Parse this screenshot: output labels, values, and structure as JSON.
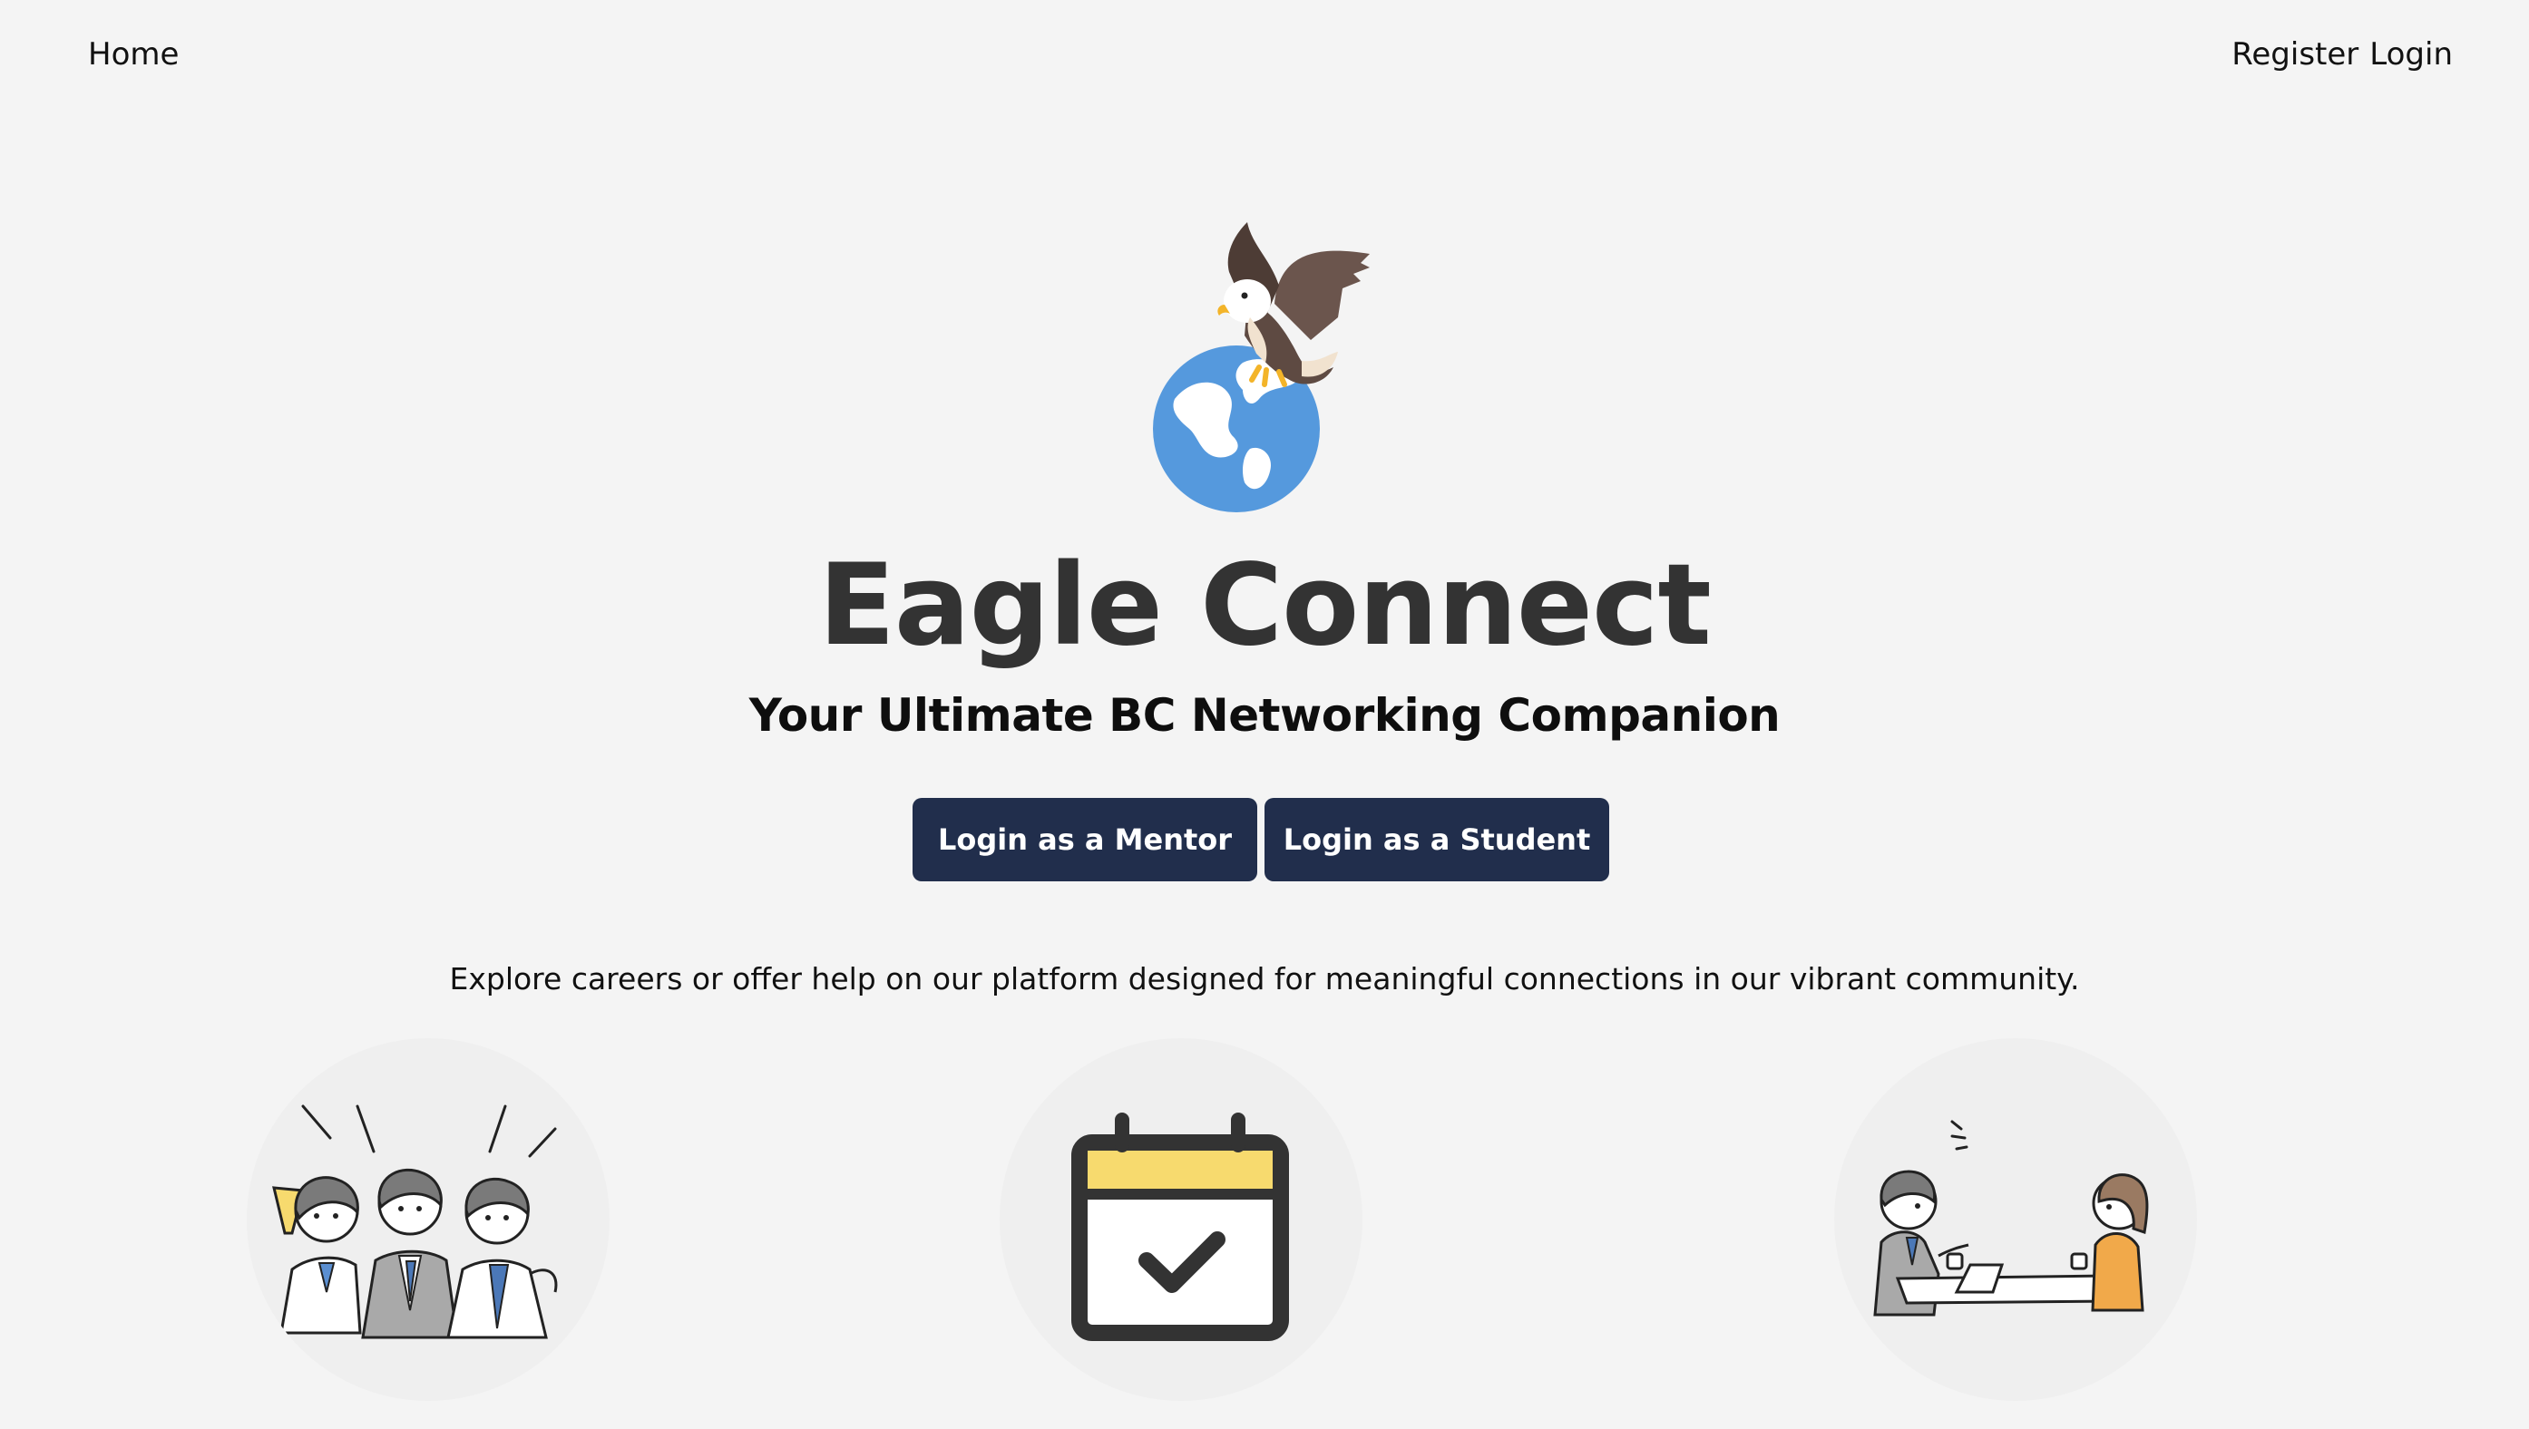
{
  "nav": {
    "home_label": "Home",
    "register_label": "Register",
    "login_label": "Login"
  },
  "hero": {
    "logo_icon": "eagle-globe-logo",
    "title": "Eagle Connect",
    "subtitle": "Your Ultimate BC Networking Companion",
    "mentor_button_label": "Login as a Mentor",
    "student_button_label": "Login as a Student",
    "tagline": "Explore careers or offer help on our platform designed for meaningful connections in our vibrant community."
  },
  "features": [
    {
      "icon": "team-cheering-illustration"
    },
    {
      "icon": "calendar-check-icon"
    },
    {
      "icon": "mentoring-meeting-illustration"
    }
  ],
  "colors": {
    "background": "#f4f4f4",
    "button": "#212e4c",
    "title": "#333333",
    "globe": "#5599dd",
    "calendar_header": "#f7da6e"
  }
}
